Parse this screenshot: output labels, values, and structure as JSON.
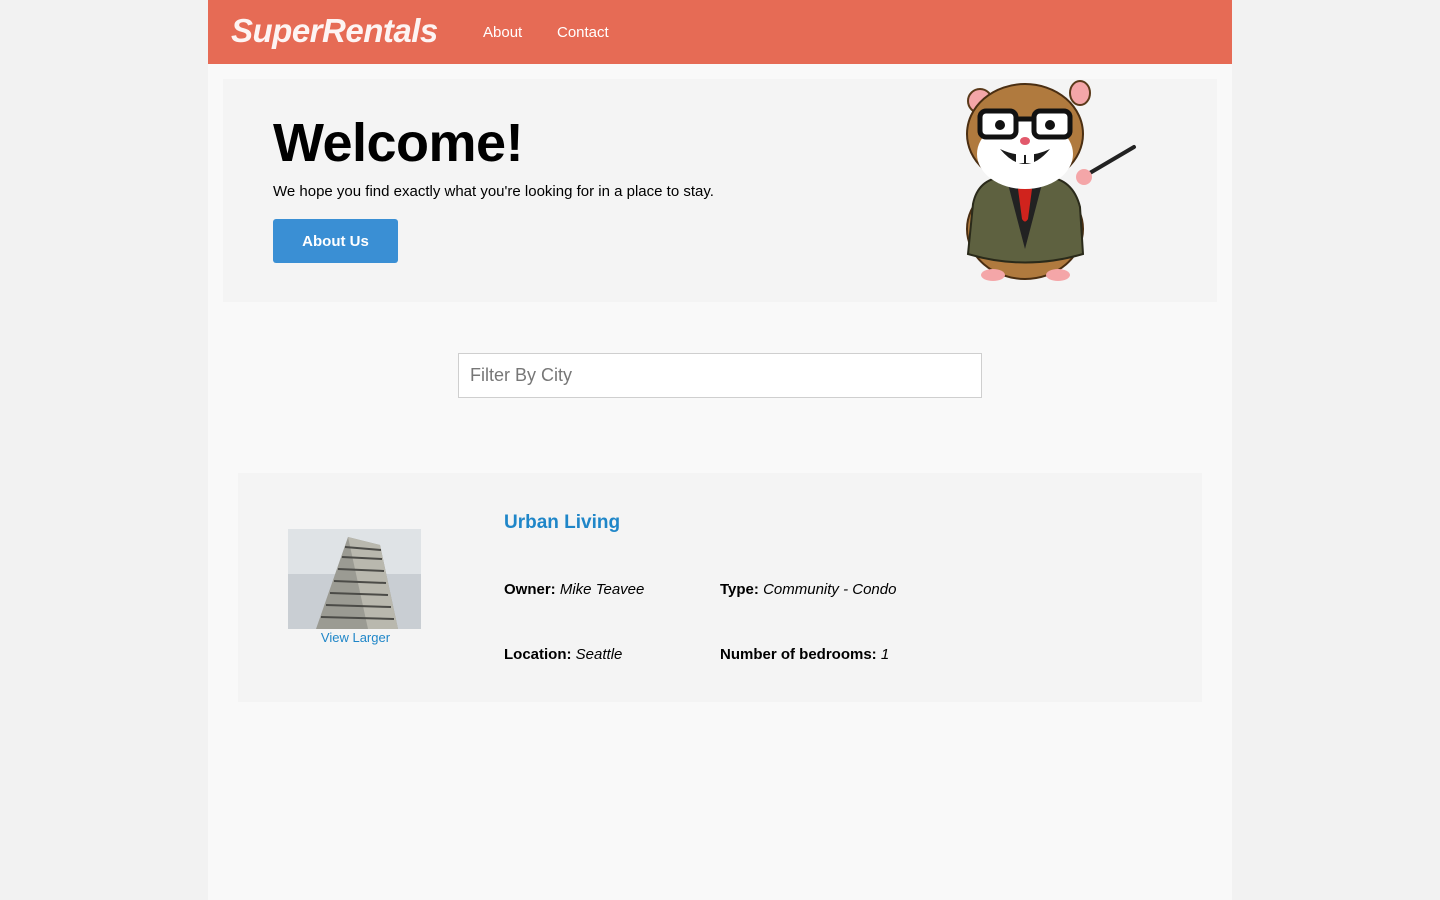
{
  "nav": {
    "brand": "SuperRentals",
    "links": [
      "About",
      "Contact"
    ]
  },
  "jumbo": {
    "title": "Welcome!",
    "subtitle": "We hope you find exactly what you're looking for in a place to stay.",
    "button": "About Us"
  },
  "filter": {
    "placeholder": "Filter By City",
    "value": ""
  },
  "listings": [
    {
      "title": "Urban Living",
      "image_link": "View Larger",
      "owner_label": "Owner:",
      "owner": "Mike Teavee",
      "type_label": "Type:",
      "type": "Community - Condo",
      "location_label": "Location:",
      "location": "Seattle",
      "bedrooms_label": "Number of bedrooms:",
      "bedrooms": "1"
    }
  ],
  "colors": {
    "navbar": "#e66b55",
    "button": "#3a8fd4",
    "link": "#1f86c8",
    "page_bg": "#f9f9f9",
    "panel_bg": "#f4f4f4"
  },
  "icons": {
    "mascot": "tomster-hamster-mascot",
    "listing_image": "apartment-building-photo"
  }
}
